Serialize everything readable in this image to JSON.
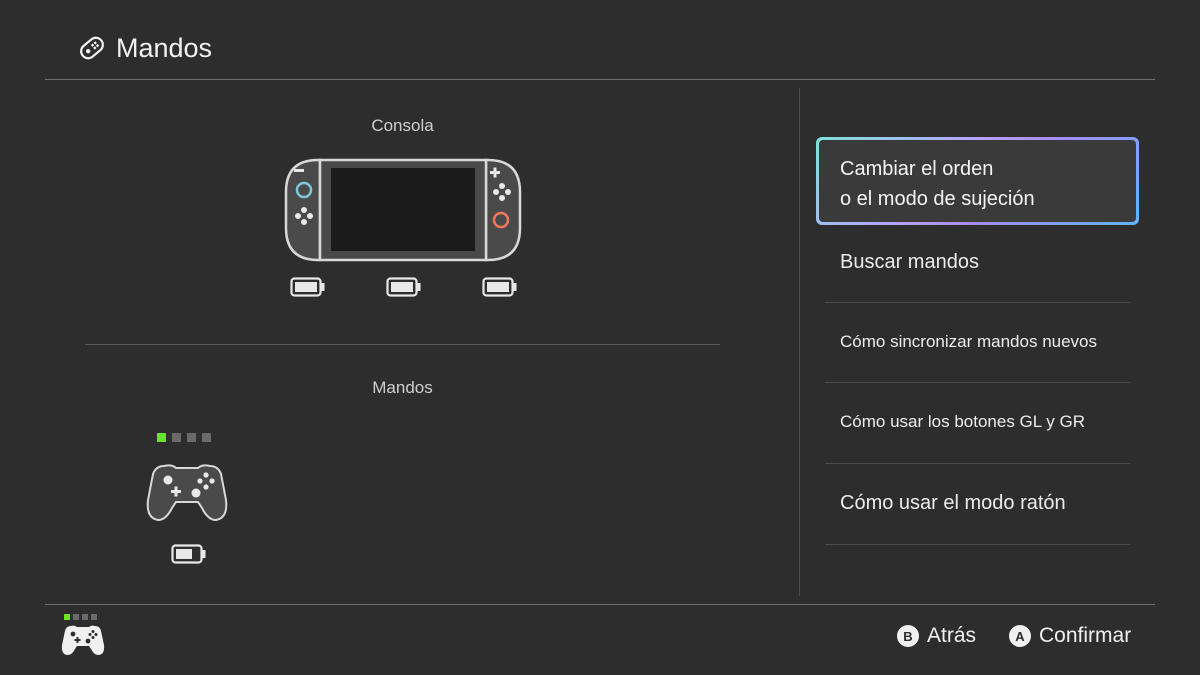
{
  "header": {
    "title": "Mandos",
    "icon": "joycon-icon"
  },
  "console_section": {
    "label": "Consola",
    "batteries": 3
  },
  "controllers_section": {
    "label": "Mandos",
    "player_leds_active": 1,
    "player_leds_total": 4
  },
  "menu": {
    "selected_line1": "Cambiar el orden",
    "selected_line2": "o el modo de sujeción",
    "items": [
      {
        "label": "Buscar mandos"
      },
      {
        "label": "Cómo sincronizar mandos nuevos"
      },
      {
        "label": "Cómo usar los botones GL y GR"
      },
      {
        "label": "Cómo usar el modo ratón"
      }
    ]
  },
  "footer": {
    "back_button": "B",
    "back_label": "Atrás",
    "confirm_button": "A",
    "confirm_label": "Confirmar"
  },
  "colors": {
    "accent_green": "#6de22a",
    "joycon_blue": "#7ec8dd",
    "joycon_orange": "#f07a57"
  }
}
